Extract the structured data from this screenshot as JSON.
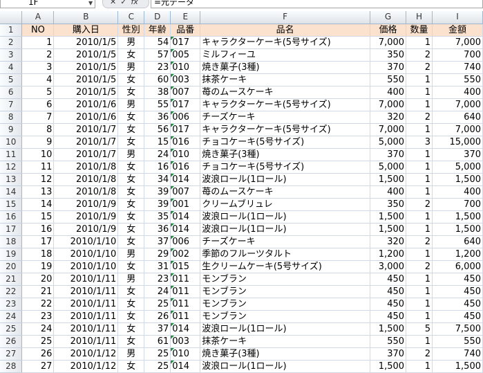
{
  "formula_bar": {
    "name_box": "1F",
    "input": "=元データ"
  },
  "columns": [
    "A",
    "B",
    "C",
    "D",
    "E",
    "F",
    "G",
    "H",
    "I"
  ],
  "header": [
    "NO",
    "購入日",
    "性別",
    "年齢",
    "品番",
    "品名",
    "価格",
    "数量",
    "金額"
  ],
  "rows": [
    [
      "1",
      "2010/1/5",
      "男",
      "54",
      "017",
      "キャラクターケーキ(5号サイズ)",
      "7,000",
      "1",
      "7,000"
    ],
    [
      "2",
      "2010/1/5",
      "女",
      "57",
      "005",
      "ミルフィーユ",
      "350",
      "2",
      "700"
    ],
    [
      "3",
      "2010/1/5",
      "男",
      "23",
      "010",
      "焼き菓子(3種)",
      "370",
      "2",
      "740"
    ],
    [
      "4",
      "2010/1/5",
      "女",
      "60",
      "003",
      "抹茶ケーキ",
      "550",
      "1",
      "550"
    ],
    [
      "5",
      "2010/1/5",
      "女",
      "38",
      "007",
      "苺のムースケーキ",
      "400",
      "1",
      "400"
    ],
    [
      "6",
      "2010/1/6",
      "男",
      "55",
      "017",
      "キャラクターケーキ(5号サイズ)",
      "7,000",
      "1",
      "7,000"
    ],
    [
      "7",
      "2010/1/6",
      "女",
      "36",
      "006",
      "チーズケーキ",
      "320",
      "2",
      "640"
    ],
    [
      "8",
      "2010/1/7",
      "女",
      "56",
      "017",
      "キャラクターケーキ(5号サイズ)",
      "7,000",
      "1",
      "7,000"
    ],
    [
      "9",
      "2010/1/7",
      "女",
      "15",
      "016",
      "チョコケーキ(5号サイズ)",
      "5,000",
      "3",
      "15,000"
    ],
    [
      "10",
      "2010/1/7",
      "男",
      "24",
      "010",
      "焼き菓子(3種)",
      "370",
      "1",
      "370"
    ],
    [
      "11",
      "2010/1/8",
      "女",
      "16",
      "016",
      "チョコケーキ(5号サイズ)",
      "5,000",
      "1",
      "5,000"
    ],
    [
      "12",
      "2010/1/8",
      "女",
      "34",
      "014",
      "波浪ロール(1ロール)",
      "1,500",
      "1",
      "1,500"
    ],
    [
      "13",
      "2010/1/8",
      "女",
      "39",
      "007",
      "苺のムースケーキ",
      "400",
      "1",
      "400"
    ],
    [
      "14",
      "2010/1/9",
      "女",
      "39",
      "001",
      "クリームブリュレ",
      "350",
      "2",
      "700"
    ],
    [
      "15",
      "2010/1/9",
      "女",
      "35",
      "014",
      "波浪ロール(1ロール)",
      "1,500",
      "1",
      "1,500"
    ],
    [
      "16",
      "2010/1/9",
      "女",
      "36",
      "014",
      "波浪ロール(1ロール)",
      "1,500",
      "1",
      "1,500"
    ],
    [
      "17",
      "2010/1/10",
      "女",
      "37",
      "006",
      "チーズケーキ",
      "320",
      "2",
      "640"
    ],
    [
      "18",
      "2010/1/10",
      "男",
      "29",
      "002",
      "季節のフルーツタルト",
      "1,200",
      "1",
      "1,200"
    ],
    [
      "19",
      "2010/1/10",
      "女",
      "31",
      "015",
      "生クリームケーキ(5号サイズ)",
      "3,000",
      "2",
      "6,000"
    ],
    [
      "20",
      "2010/1/11",
      "男",
      "23",
      "011",
      "モンブラン",
      "450",
      "1",
      "450"
    ],
    [
      "21",
      "2010/1/11",
      "女",
      "24",
      "011",
      "モンブラン",
      "450",
      "1",
      "450"
    ],
    [
      "22",
      "2010/1/11",
      "女",
      "25",
      "011",
      "モンブラン",
      "450",
      "1",
      "450"
    ],
    [
      "23",
      "2010/1/11",
      "女",
      "26",
      "011",
      "モンブラン",
      "450",
      "1",
      "450"
    ],
    [
      "24",
      "2010/1/11",
      "女",
      "37",
      "014",
      "波浪ロール(1ロール)",
      "1,500",
      "5",
      "7,500"
    ],
    [
      "25",
      "2010/1/11",
      "女",
      "61",
      "003",
      "抹茶ケーキ",
      "550",
      "1",
      "550"
    ],
    [
      "26",
      "2010/1/12",
      "男",
      "25",
      "010",
      "焼き菓子(3種)",
      "370",
      "2",
      "740"
    ],
    [
      "27",
      "2010/1/12",
      "女",
      "25",
      "014",
      "波浪ロール(1ロール)",
      "1,500",
      "1",
      "1,500"
    ]
  ],
  "colors": {
    "header_fill": "#fbe2cf",
    "grid_line": "#d0d7e5",
    "text_indicator": "#1f8c3b"
  }
}
